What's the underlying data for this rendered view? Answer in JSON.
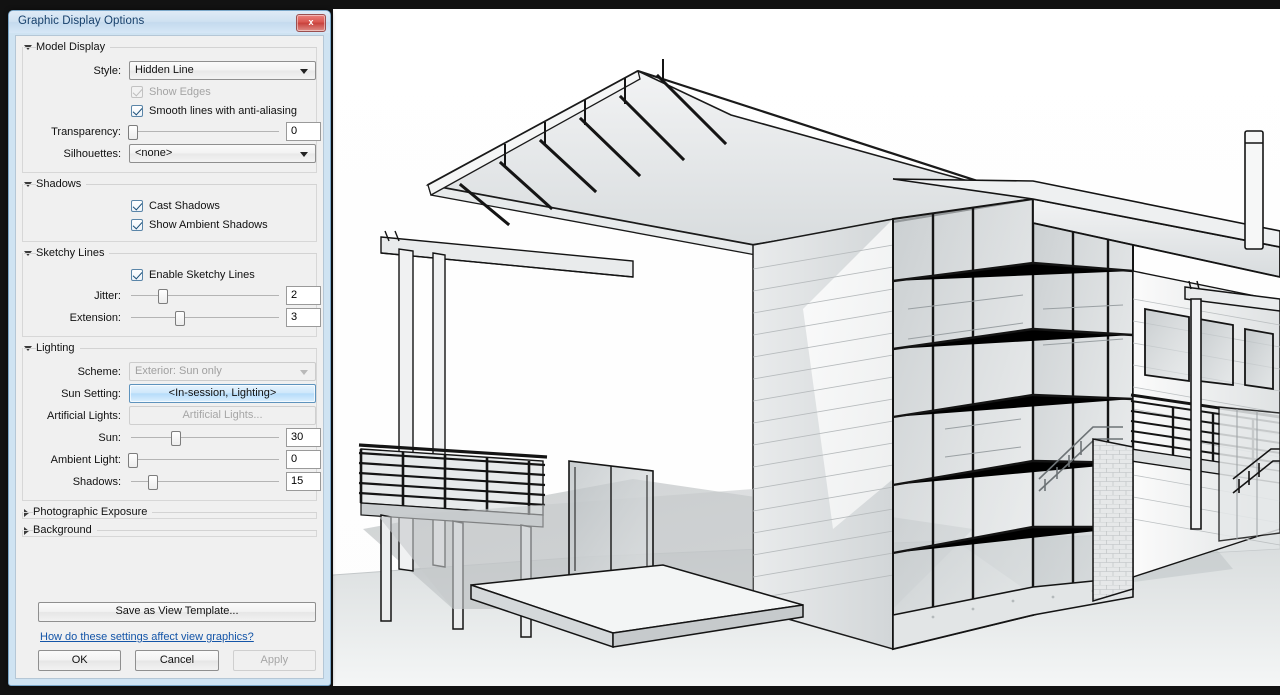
{
  "dialog": {
    "title": "Graphic Display Options",
    "close_label": "x",
    "groups": {
      "model_display": {
        "label": "Model Display",
        "expanded": true,
        "style_label": "Style:",
        "style_value": "Hidden Line",
        "show_edges_label": "Show Edges",
        "show_edges_checked": true,
        "show_edges_enabled": false,
        "smooth_lines_label": "Smooth lines with anti-aliasing",
        "smooth_lines_checked": true,
        "transparency_label": "Transparency:",
        "transparency_value": "0",
        "transparency_pct": 2,
        "silhouettes_label": "Silhouettes:",
        "silhouettes_value": "<none>"
      },
      "shadows": {
        "label": "Shadows",
        "expanded": true,
        "cast_shadows_label": "Cast Shadows",
        "cast_shadows_checked": true,
        "ambient_shadows_label": "Show Ambient Shadows",
        "ambient_shadows_checked": true
      },
      "sketchy_lines": {
        "label": "Sketchy Lines",
        "expanded": true,
        "enable_label": "Enable Sketchy Lines",
        "enable_checked": true,
        "jitter_label": "Jitter:",
        "jitter_value": "2",
        "jitter_pct": 22,
        "extension_label": "Extension:",
        "extension_value": "3",
        "extension_pct": 33
      },
      "lighting": {
        "label": "Lighting",
        "expanded": true,
        "scheme_label": "Scheme:",
        "scheme_value": "Exterior: Sun only",
        "scheme_enabled": false,
        "sun_setting_label": "Sun Setting:",
        "sun_setting_value": "<In-session, Lighting>",
        "artificial_lights_label": "Artificial Lights:",
        "artificial_lights_value": "Artificial Lights...",
        "artificial_lights_enabled": false,
        "sun_label": "Sun:",
        "sun_value": "30",
        "sun_pct": 30,
        "ambient_light_label": "Ambient Light:",
        "ambient_light_value": "0",
        "ambient_light_pct": 2,
        "shadows_label": "Shadows:",
        "shadows_value": "15",
        "shadows_pct": 15
      },
      "photographic_exposure": {
        "label": "Photographic Exposure",
        "expanded": false
      },
      "background": {
        "label": "Background",
        "expanded": false
      }
    },
    "save_template_label": "Save as View Template...",
    "help_link_label": "How do these settings affect view graphics?",
    "ok_label": "OK",
    "cancel_label": "Cancel",
    "apply_label": "Apply",
    "apply_enabled": false
  },
  "viewport": {
    "name": "3d-model-view",
    "description": "Hidden-line architectural 3D perspective of a modern house with cantilevered shed roof, curtain-wall glazing, deck railings, chimney and brick wall",
    "background_color": "#ffffff",
    "line_color": "#1a1a1a",
    "ground_color": "#cfd3d4"
  },
  "colors": {
    "desktop": "#121212",
    "dialog_frame": "#cfe3f2",
    "dialog_body": "#f0f0f0",
    "accent_blue": "#b6dcfa",
    "link": "#1455a8",
    "close_red": "#d9564f"
  }
}
